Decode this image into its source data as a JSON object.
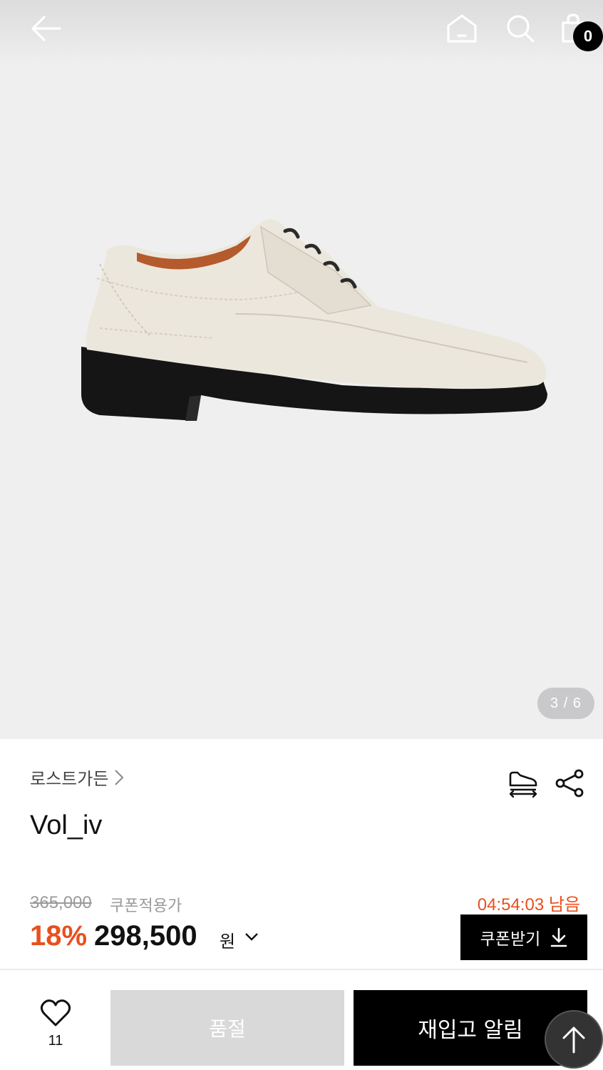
{
  "header": {
    "back_icon": "arrow-left-icon",
    "home_icon": "home-icon",
    "search_icon": "search-icon",
    "cart_icon": "shopping-bag-icon",
    "cart_count": "0"
  },
  "gallery": {
    "current": 3,
    "total": 6,
    "indicator": "3 / 6",
    "image_alt": "shoe-image"
  },
  "product": {
    "brand": "로스트가든",
    "name": "Vol_iv",
    "fit_icon": "shoe-size-icon",
    "share_icon": "share-icon"
  },
  "price": {
    "original": "365,000",
    "coupon_label": "쿠폰적용가",
    "timer": "04:54:03 남음",
    "discount": "18%",
    "sale": "298,500",
    "currency": "원",
    "coupon_button": "쿠폰받기",
    "accent_color": "#e8501e"
  },
  "bottom_bar": {
    "like_count": "11",
    "soldout_label": "품절",
    "restock_label": "재입고 알림"
  }
}
